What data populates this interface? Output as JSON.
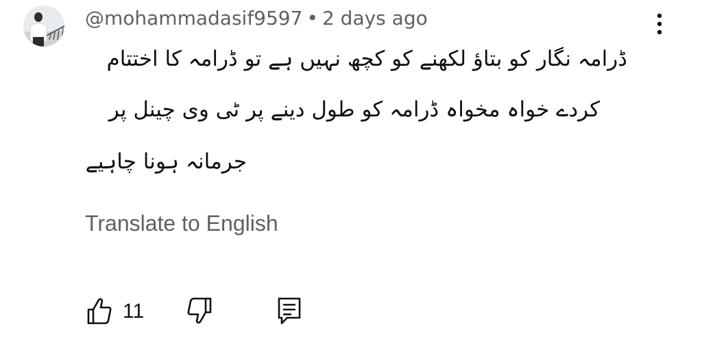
{
  "comment": {
    "author": "@mohammadasif9597",
    "separator": "•",
    "time": "2 days ago",
    "text_lines": [
      "ڈرامہ نگار کو بتاؤ لکھنے کو کچھ نہیں ہے تو ڈرامہ کا اختتام",
      "کردے خواہ مخواہ ڈرامہ کو طول دینے پر ٹی وی چینل پر",
      "جرمانہ ہونا چاہیے"
    ],
    "translate_label": "Translate to English",
    "like_count": "11"
  },
  "icons": {
    "more": "more-vert-icon",
    "like": "thumb-up-icon",
    "dislike": "thumb-down-icon",
    "reply": "comment-reply-icon"
  },
  "colors": {
    "secondary_text": "#606060",
    "primary_text": "#0f0f0f"
  }
}
